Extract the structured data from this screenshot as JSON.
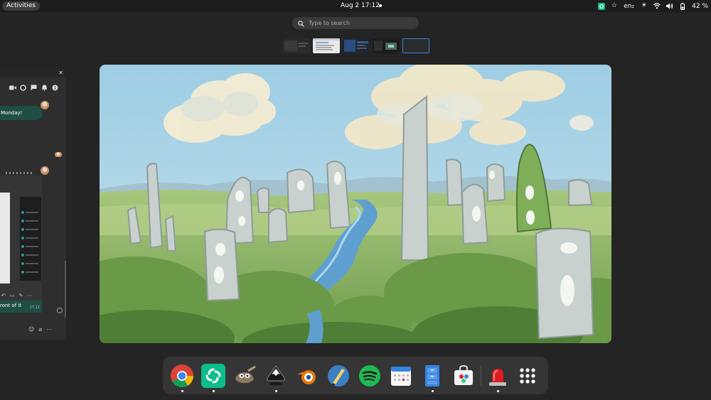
{
  "topbar": {
    "activities_label": "Activities",
    "clock": "Aug 2  17:12",
    "keyboard_layout": "en₂",
    "battery": "42 %"
  },
  "search": {
    "placeholder": "Type to search"
  },
  "chat_window": {
    "bubble_text": "Monday!",
    "message_text": "ront of it",
    "message_time": "17:12"
  },
  "dock": {
    "apps": [
      "Chrome",
      "Element",
      "GIMP",
      "Inkscape",
      "Blender",
      "Xournal",
      "Spotify",
      "Calendar",
      "Files",
      "Software",
      "Alarm",
      "Show Apps"
    ]
  },
  "colors": {
    "accent": "#3584e4",
    "chat_bubble": "#1f4e44",
    "panel": "#1c1c1c",
    "background": "#242424",
    "sky": "#a9d2e6",
    "grass": "#7aa35a"
  }
}
